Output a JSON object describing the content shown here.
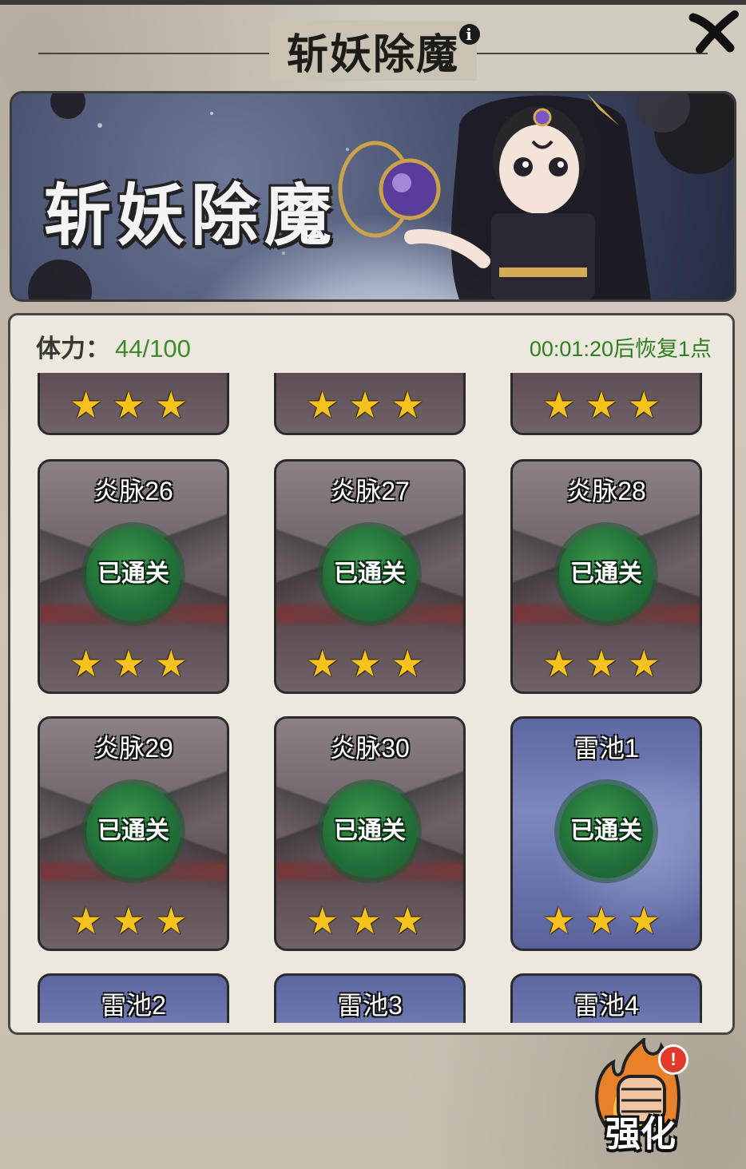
{
  "header": {
    "title": "斩妖除魔",
    "info_icon": "info-icon",
    "close_icon": "close-x-icon"
  },
  "banner": {
    "title": "斩妖除魔"
  },
  "stamina": {
    "label": "体力：",
    "value": "44/100",
    "recover_text": "00:01:20后恢复1点"
  },
  "stages": {
    "cleared_label": "已通关",
    "star_glyph": "★★★",
    "rows": [
      {
        "name": "",
        "stars": 3,
        "theme": "volcano"
      },
      {
        "name": "炎脉26",
        "stars": 3,
        "theme": "volcano"
      },
      {
        "name": "炎脉27",
        "stars": 3,
        "theme": "volcano"
      },
      {
        "name": "炎脉28",
        "stars": 3,
        "theme": "volcano"
      },
      {
        "name": "炎脉29",
        "stars": 3,
        "theme": "volcano"
      },
      {
        "name": "炎脉30",
        "stars": 3,
        "theme": "volcano"
      },
      {
        "name": "雷池1",
        "stars": 3,
        "theme": "thunder"
      },
      {
        "name": "雷池2",
        "theme": "thunder"
      },
      {
        "name": "雷池3",
        "theme": "thunder"
      },
      {
        "name": "雷池4",
        "theme": "thunder"
      }
    ]
  },
  "boost": {
    "label": "强化",
    "badge": "!",
    "icon": "fist-flame-icon"
  },
  "colors": {
    "background": "#c9c3b4",
    "panel": "#ece8de",
    "stamina_value": "#3c8a2a",
    "cleared_badge": "#22703a",
    "star": "#f6c21e"
  }
}
